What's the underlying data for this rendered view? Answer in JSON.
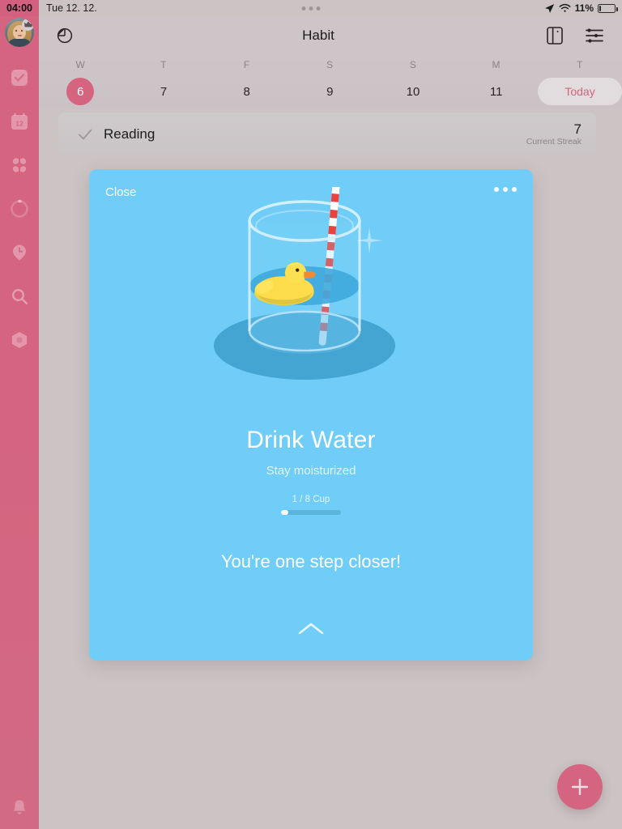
{
  "statusbar": {
    "time": "04:00",
    "date": "Tue 12. 12.",
    "battery_percent": "11%"
  },
  "sidebar": {
    "items": [
      {
        "name": "avatar",
        "label": ""
      },
      {
        "name": "tasks-check",
        "label": ""
      },
      {
        "name": "calendar",
        "label": "12"
      },
      {
        "name": "grid",
        "label": ""
      },
      {
        "name": "progress-ring",
        "label": ""
      },
      {
        "name": "timer-pin",
        "label": ""
      },
      {
        "name": "search",
        "label": ""
      },
      {
        "name": "hexagon",
        "label": ""
      }
    ],
    "bell": ""
  },
  "topbar": {
    "title": "Habit",
    "stats_icon": "pie-chart-icon",
    "layout_icon": "sidebar-layout-icon",
    "filter_icon": "filter-sliders-icon"
  },
  "datestrip": {
    "days": [
      {
        "dow": "W",
        "num": "6",
        "selected": true
      },
      {
        "dow": "T",
        "num": "7",
        "selected": false
      },
      {
        "dow": "F",
        "num": "8",
        "selected": false
      },
      {
        "dow": "S",
        "num": "9",
        "selected": false
      },
      {
        "dow": "S",
        "num": "10",
        "selected": false
      },
      {
        "dow": "M",
        "num": "11",
        "selected": false
      },
      {
        "dow": "T",
        "num": "",
        "selected": false
      }
    ],
    "today_label": "Today"
  },
  "habit_row": {
    "name": "Reading",
    "streak_value": "7",
    "streak_label": "Current Streak"
  },
  "card": {
    "close_label": "Close",
    "title": "Drink Water",
    "subtitle": "Stay moisturized",
    "progress_label": "1 / 8 Cup",
    "progress_percent": 12,
    "message": "You're one step closer!",
    "background_color": "#6fcdf7",
    "illustration": "glass-of-water-with-duck-and-straw"
  },
  "fab": {
    "label": "+",
    "color": "#d4647f"
  }
}
